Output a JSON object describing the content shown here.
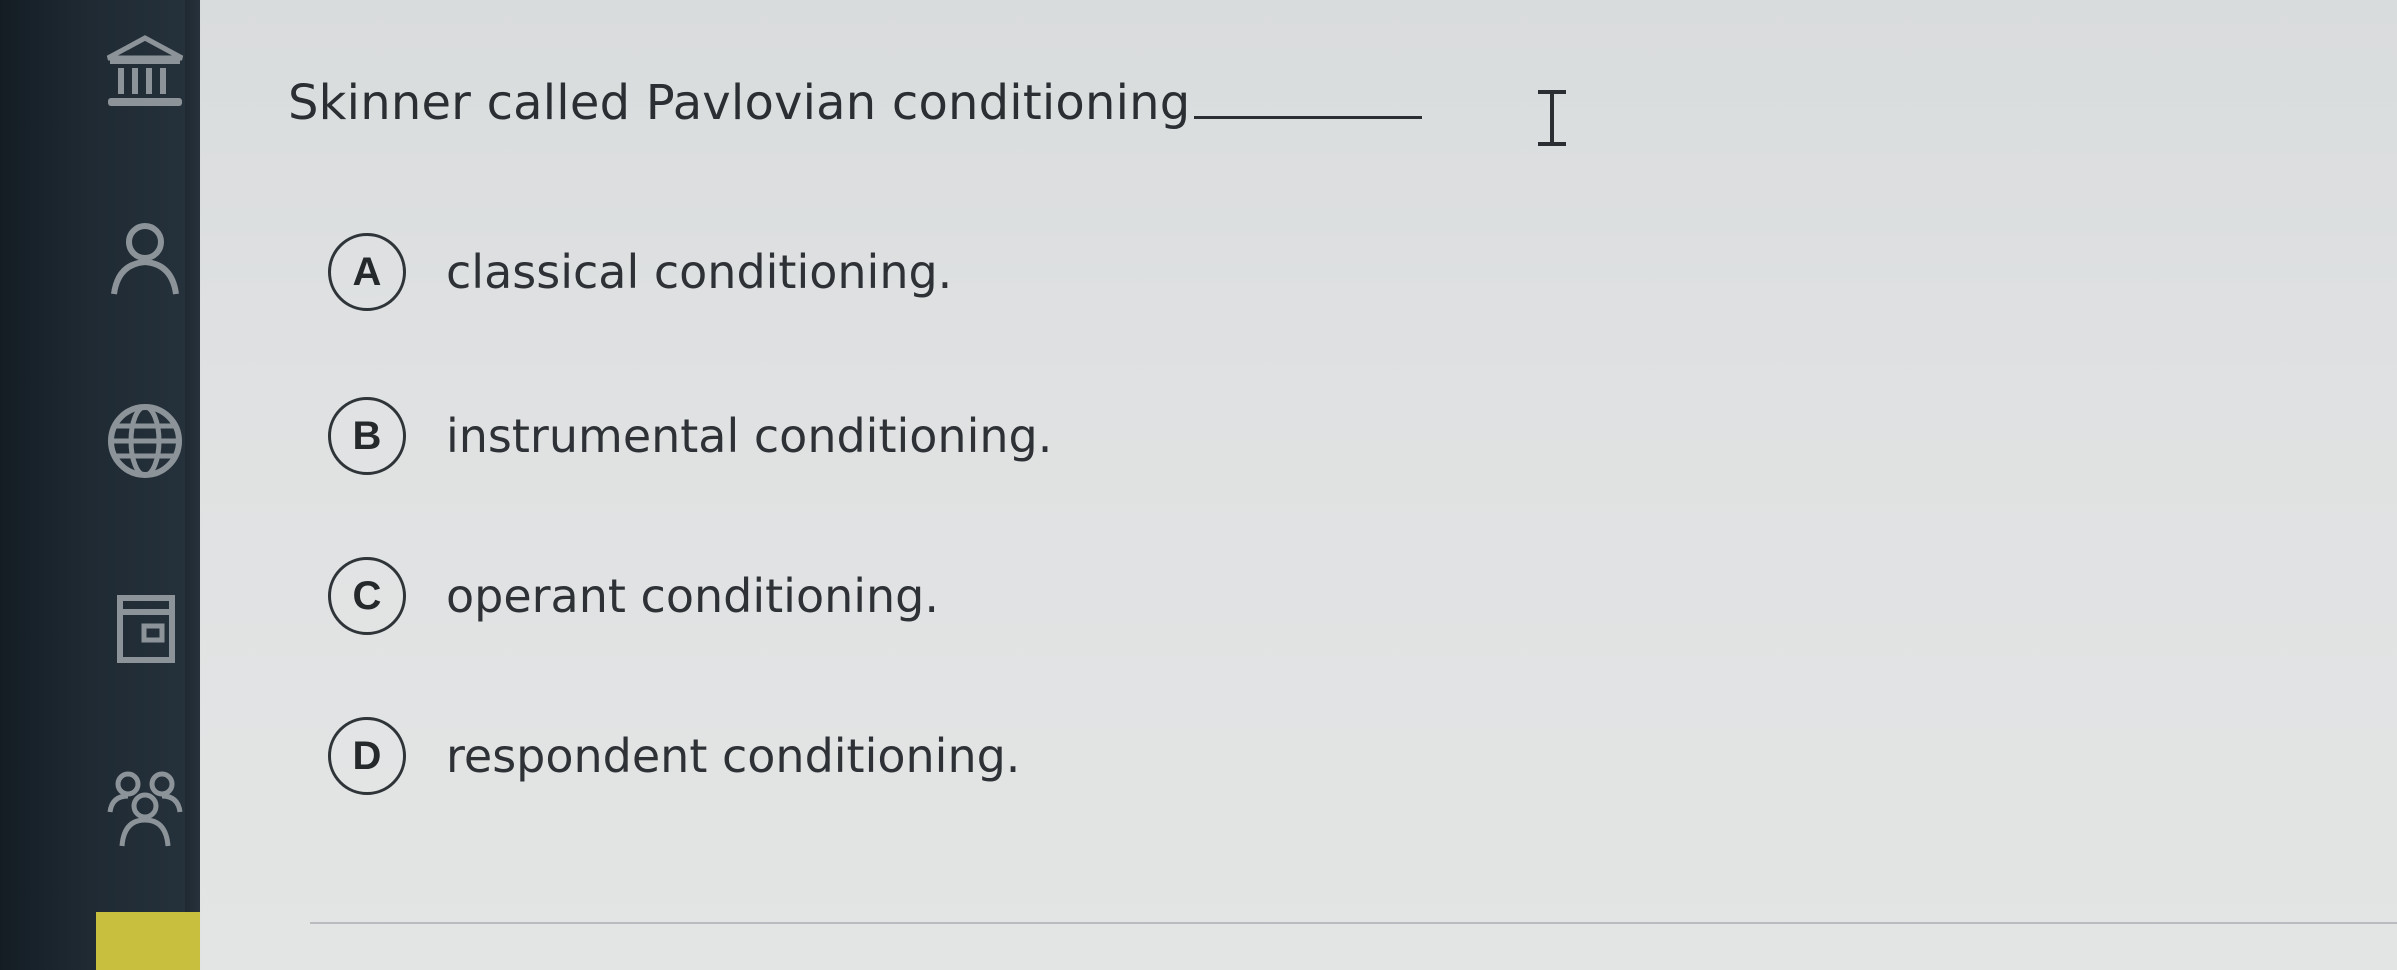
{
  "question": {
    "prompt": "Skinner called Pavlovian conditioning"
  },
  "options": [
    {
      "letter": "A",
      "text": "classical conditioning."
    },
    {
      "letter": "B",
      "text": "instrumental conditioning."
    },
    {
      "letter": "C",
      "text": "operant conditioning."
    },
    {
      "letter": "D",
      "text": "respondent conditioning."
    }
  ],
  "sidebar": {
    "icons": [
      "institution-icon",
      "user-icon",
      "globe-icon",
      "calendar-icon",
      "group-icon"
    ],
    "accent_color": "#c9bf3e"
  },
  "colors": {
    "sidebar_bg": "#1f2a33",
    "page_bg": "#e0e2e3",
    "text": "#2b2f33"
  }
}
